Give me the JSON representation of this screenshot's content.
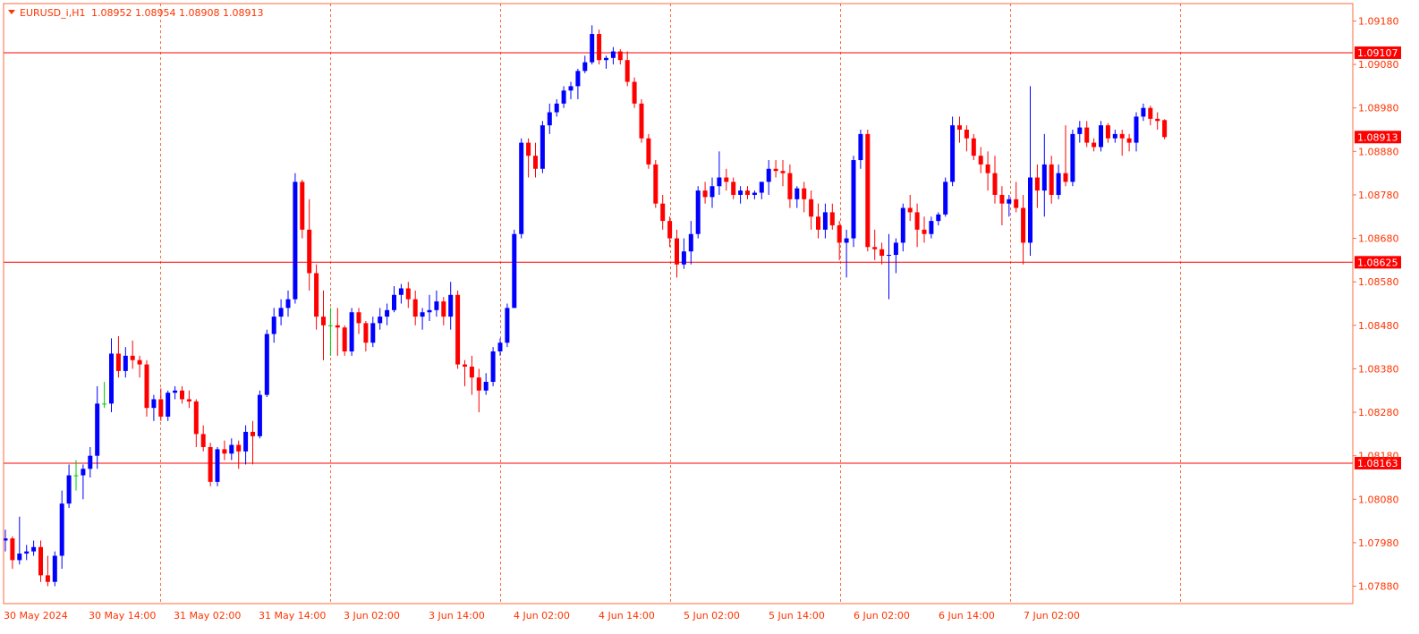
{
  "header": {
    "symbol": "EURUSD_i,H1",
    "ohlc": "1.08952 1.08954 1.08908 1.08913"
  },
  "colors": {
    "bull": "#0000ff",
    "bear": "#ff0000",
    "doji": "#00cc00",
    "grid": "#ff6a3d",
    "axis_text": "#ff3300",
    "border": "#ff6a3d",
    "level_line": "#ff0000",
    "tag_bg": "#ff0000",
    "tag_text": "#ffffff"
  },
  "chart_data": {
    "type": "candlestick",
    "symbol": "EURUSD_i",
    "timeframe": "H1",
    "ylim": [
      1.0784,
      1.0922
    ],
    "y_ticks": [
      "1.09180",
      "1.09080",
      "1.08980",
      "1.08880",
      "1.08780",
      "1.08680",
      "1.08580",
      "1.08480",
      "1.08380",
      "1.08280",
      "1.08180",
      "1.08080",
      "1.07980",
      "1.07880"
    ],
    "x_ticks": [
      "30 May 2024",
      "30 May 14:00",
      "31 May 02:00",
      "31 May 14:00",
      "3 Jun 02:00",
      "3 Jun 14:00",
      "4 Jun 02:00",
      "4 Jun 14:00",
      "5 Jun 02:00",
      "5 Jun 14:00",
      "6 Jun 02:00",
      "6 Jun 14:00",
      "7 Jun 02:00"
    ],
    "horizontal_levels": [
      "1.09107",
      "1.08625",
      "1.08163"
    ],
    "current_price": "1.08913",
    "grid": "vertical dashed",
    "candles": [
      {
        "o": 1.07985,
        "h": 1.0801,
        "l": 1.0796,
        "c": 1.0799
      },
      {
        "o": 1.0799,
        "h": 1.07995,
        "l": 1.0792,
        "c": 1.0794
      },
      {
        "o": 1.0794,
        "h": 1.0804,
        "l": 1.0793,
        "c": 1.07955
      },
      {
        "o": 1.07955,
        "h": 1.07975,
        "l": 1.0794,
        "c": 1.0796
      },
      {
        "o": 1.0796,
        "h": 1.07985,
        "l": 1.0795,
        "c": 1.0797
      },
      {
        "o": 1.0797,
        "h": 1.07985,
        "l": 1.0789,
        "c": 1.07905
      },
      {
        "o": 1.07905,
        "h": 1.0795,
        "l": 1.0788,
        "c": 1.0789
      },
      {
        "o": 1.0789,
        "h": 1.0796,
        "l": 1.0788,
        "c": 1.0795
      },
      {
        "o": 1.0795,
        "h": 1.081,
        "l": 1.0792,
        "c": 1.0807
      },
      {
        "o": 1.0807,
        "h": 1.0816,
        "l": 1.0806,
        "c": 1.08135
      },
      {
        "o": 1.08135,
        "h": 1.0817,
        "l": 1.081,
        "c": 1.08135
      },
      {
        "o": 1.08135,
        "h": 1.0816,
        "l": 1.0808,
        "c": 1.0815
      },
      {
        "o": 1.0815,
        "h": 1.082,
        "l": 1.0813,
        "c": 1.0818
      },
      {
        "o": 1.0818,
        "h": 1.0834,
        "l": 1.0815,
        "c": 1.083
      },
      {
        "o": 1.083,
        "h": 1.0835,
        "l": 1.0829,
        "c": 1.083
      },
      {
        "o": 1.083,
        "h": 1.0845,
        "l": 1.0828,
        "c": 1.08415
      },
      {
        "o": 1.08415,
        "h": 1.08455,
        "l": 1.0836,
        "c": 1.08375
      },
      {
        "o": 1.08375,
        "h": 1.0843,
        "l": 1.0836,
        "c": 1.0841
      },
      {
        "o": 1.0841,
        "h": 1.08445,
        "l": 1.0838,
        "c": 1.084
      },
      {
        "o": 1.084,
        "h": 1.0841,
        "l": 1.0836,
        "c": 1.0839
      },
      {
        "o": 1.0839,
        "h": 1.084,
        "l": 1.0827,
        "c": 1.0829
      },
      {
        "o": 1.0829,
        "h": 1.0832,
        "l": 1.0826,
        "c": 1.0831
      },
      {
        "o": 1.0831,
        "h": 1.08335,
        "l": 1.0826,
        "c": 1.0827
      },
      {
        "o": 1.0827,
        "h": 1.0833,
        "l": 1.0826,
        "c": 1.08325
      },
      {
        "o": 1.08325,
        "h": 1.0834,
        "l": 1.0831,
        "c": 1.0833
      },
      {
        "o": 1.0833,
        "h": 1.0834,
        "l": 1.083,
        "c": 1.0831
      },
      {
        "o": 1.0831,
        "h": 1.0833,
        "l": 1.0829,
        "c": 1.08305
      },
      {
        "o": 1.08305,
        "h": 1.0831,
        "l": 1.082,
        "c": 1.0823
      },
      {
        "o": 1.0823,
        "h": 1.0825,
        "l": 1.0819,
        "c": 1.082
      },
      {
        "o": 1.082,
        "h": 1.0821,
        "l": 1.0811,
        "c": 1.0812
      },
      {
        "o": 1.0812,
        "h": 1.082,
        "l": 1.0811,
        "c": 1.08195
      },
      {
        "o": 1.08195,
        "h": 1.08215,
        "l": 1.0817,
        "c": 1.08185
      },
      {
        "o": 1.08185,
        "h": 1.0822,
        "l": 1.0817,
        "c": 1.08205
      },
      {
        "o": 1.08205,
        "h": 1.08215,
        "l": 1.0815,
        "c": 1.0819
      },
      {
        "o": 1.0819,
        "h": 1.0825,
        "l": 1.0816,
        "c": 1.08235
      },
      {
        "o": 1.08235,
        "h": 1.0826,
        "l": 1.0816,
        "c": 1.08225
      },
      {
        "o": 1.08225,
        "h": 1.0833,
        "l": 1.0822,
        "c": 1.0832
      },
      {
        "o": 1.0832,
        "h": 1.0847,
        "l": 1.08315,
        "c": 1.0846
      },
      {
        "o": 1.0846,
        "h": 1.0852,
        "l": 1.0844,
        "c": 1.085
      },
      {
        "o": 1.085,
        "h": 1.0854,
        "l": 1.0848,
        "c": 1.0852
      },
      {
        "o": 1.0852,
        "h": 1.0856,
        "l": 1.085,
        "c": 1.0854
      },
      {
        "o": 1.0854,
        "h": 1.0883,
        "l": 1.0853,
        "c": 1.0881
      },
      {
        "o": 1.0881,
        "h": 1.08815,
        "l": 1.0868,
        "c": 1.087
      },
      {
        "o": 1.087,
        "h": 1.0877,
        "l": 1.0856,
        "c": 1.086
      },
      {
        "o": 1.086,
        "h": 1.0862,
        "l": 1.0847,
        "c": 1.085
      },
      {
        "o": 1.085,
        "h": 1.0856,
        "l": 1.084,
        "c": 1.0848
      },
      {
        "o": 1.0848,
        "h": 1.0852,
        "l": 1.0841,
        "c": 1.0848
      },
      {
        "o": 1.0848,
        "h": 1.0852,
        "l": 1.0841,
        "c": 1.08475
      },
      {
        "o": 1.08475,
        "h": 1.0848,
        "l": 1.0841,
        "c": 1.0842
      },
      {
        "o": 1.0842,
        "h": 1.0852,
        "l": 1.0841,
        "c": 1.0851
      },
      {
        "o": 1.0851,
        "h": 1.0852,
        "l": 1.0846,
        "c": 1.08485
      },
      {
        "o": 1.08485,
        "h": 1.0849,
        "l": 1.0842,
        "c": 1.0844
      },
      {
        "o": 1.0844,
        "h": 1.085,
        "l": 1.0843,
        "c": 1.08485
      },
      {
        "o": 1.08485,
        "h": 1.0852,
        "l": 1.0847,
        "c": 1.085
      },
      {
        "o": 1.085,
        "h": 1.0853,
        "l": 1.0848,
        "c": 1.08515
      },
      {
        "o": 1.08515,
        "h": 1.0857,
        "l": 1.0851,
        "c": 1.0855
      },
      {
        "o": 1.0855,
        "h": 1.08575,
        "l": 1.0853,
        "c": 1.08565
      },
      {
        "o": 1.08565,
        "h": 1.0858,
        "l": 1.0852,
        "c": 1.0854
      },
      {
        "o": 1.0854,
        "h": 1.0856,
        "l": 1.0848,
        "c": 1.085
      },
      {
        "o": 1.085,
        "h": 1.0852,
        "l": 1.0847,
        "c": 1.0851
      },
      {
        "o": 1.0851,
        "h": 1.0855,
        "l": 1.0849,
        "c": 1.08515
      },
      {
        "o": 1.08515,
        "h": 1.0856,
        "l": 1.085,
        "c": 1.08535
      },
      {
        "o": 1.08535,
        "h": 1.08545,
        "l": 1.0848,
        "c": 1.085
      },
      {
        "o": 1.085,
        "h": 1.0858,
        "l": 1.0847,
        "c": 1.0855
      },
      {
        "o": 1.0855,
        "h": 1.0856,
        "l": 1.0838,
        "c": 1.0839
      },
      {
        "o": 1.0839,
        "h": 1.084,
        "l": 1.0834,
        "c": 1.08385
      },
      {
        "o": 1.08385,
        "h": 1.0841,
        "l": 1.0832,
        "c": 1.0836
      },
      {
        "o": 1.0836,
        "h": 1.0838,
        "l": 1.0828,
        "c": 1.0833
      },
      {
        "o": 1.0833,
        "h": 1.0837,
        "l": 1.0832,
        "c": 1.0835
      },
      {
        "o": 1.0835,
        "h": 1.0843,
        "l": 1.0834,
        "c": 1.0842
      },
      {
        "o": 1.0842,
        "h": 1.0845,
        "l": 1.0841,
        "c": 1.0844
      },
      {
        "o": 1.0844,
        "h": 1.0853,
        "l": 1.0843,
        "c": 1.0852
      },
      {
        "o": 1.0852,
        "h": 1.087,
        "l": 1.0852,
        "c": 1.0869
      },
      {
        "o": 1.0869,
        "h": 1.0891,
        "l": 1.0868,
        "c": 1.089
      },
      {
        "o": 1.089,
        "h": 1.0891,
        "l": 1.0882,
        "c": 1.0887
      },
      {
        "o": 1.0887,
        "h": 1.089,
        "l": 1.0882,
        "c": 1.0884
      },
      {
        "o": 1.0884,
        "h": 1.0895,
        "l": 1.0883,
        "c": 1.0894
      },
      {
        "o": 1.0894,
        "h": 1.0899,
        "l": 1.0892,
        "c": 1.0897
      },
      {
        "o": 1.0897,
        "h": 1.09,
        "l": 1.0896,
        "c": 1.0899
      },
      {
        "o": 1.0899,
        "h": 1.0903,
        "l": 1.0898,
        "c": 1.0902
      },
      {
        "o": 1.0902,
        "h": 1.0904,
        "l": 1.09,
        "c": 1.0903
      },
      {
        "o": 1.0903,
        "h": 1.0907,
        "l": 1.09,
        "c": 1.09065
      },
      {
        "o": 1.09065,
        "h": 1.091,
        "l": 1.0906,
        "c": 1.09085
      },
      {
        "o": 1.09085,
        "h": 1.0917,
        "l": 1.0908,
        "c": 1.0915
      },
      {
        "o": 1.0915,
        "h": 1.0916,
        "l": 1.0908,
        "c": 1.0909
      },
      {
        "o": 1.0909,
        "h": 1.091,
        "l": 1.0907,
        "c": 1.09095
      },
      {
        "o": 1.09095,
        "h": 1.0912,
        "l": 1.0908,
        "c": 1.0911
      },
      {
        "o": 1.0911,
        "h": 1.09115,
        "l": 1.0908,
        "c": 1.0909
      },
      {
        "o": 1.0909,
        "h": 1.0911,
        "l": 1.0903,
        "c": 1.0904
      },
      {
        "o": 1.0904,
        "h": 1.0905,
        "l": 1.0898,
        "c": 1.0899
      },
      {
        "o": 1.0899,
        "h": 1.09,
        "l": 1.089,
        "c": 1.0891
      },
      {
        "o": 1.0891,
        "h": 1.0892,
        "l": 1.0884,
        "c": 1.0885
      },
      {
        "o": 1.0885,
        "h": 1.0886,
        "l": 1.0875,
        "c": 1.0876
      },
      {
        "o": 1.0876,
        "h": 1.0878,
        "l": 1.087,
        "c": 1.0872
      },
      {
        "o": 1.0872,
        "h": 1.0873,
        "l": 1.0866,
        "c": 1.0868
      },
      {
        "o": 1.0868,
        "h": 1.087,
        "l": 1.0859,
        "c": 1.0862
      },
      {
        "o": 1.0862,
        "h": 1.0868,
        "l": 1.0861,
        "c": 1.0865
      },
      {
        "o": 1.0865,
        "h": 1.0872,
        "l": 1.0862,
        "c": 1.0869
      },
      {
        "o": 1.0869,
        "h": 1.088,
        "l": 1.0868,
        "c": 1.0879
      },
      {
        "o": 1.0879,
        "h": 1.0881,
        "l": 1.0876,
        "c": 1.08775
      },
      {
        "o": 1.08775,
        "h": 1.0882,
        "l": 1.0875,
        "c": 1.088
      },
      {
        "o": 1.088,
        "h": 1.0888,
        "l": 1.0878,
        "c": 1.0882
      },
      {
        "o": 1.0882,
        "h": 1.0884,
        "l": 1.0879,
        "c": 1.0881
      },
      {
        "o": 1.0881,
        "h": 1.0882,
        "l": 1.0877,
        "c": 1.0878
      },
      {
        "o": 1.0878,
        "h": 1.088,
        "l": 1.0876,
        "c": 1.0879
      },
      {
        "o": 1.0879,
        "h": 1.088,
        "l": 1.0877,
        "c": 1.0878
      },
      {
        "o": 1.0878,
        "h": 1.0879,
        "l": 1.0877,
        "c": 1.08785
      },
      {
        "o": 1.08785,
        "h": 1.0881,
        "l": 1.0877,
        "c": 1.0881
      },
      {
        "o": 1.0881,
        "h": 1.0886,
        "l": 1.0878,
        "c": 1.0884
      },
      {
        "o": 1.0884,
        "h": 1.0886,
        "l": 1.0882,
        "c": 1.08835
      },
      {
        "o": 1.08835,
        "h": 1.0886,
        "l": 1.088,
        "c": 1.0883
      },
      {
        "o": 1.0883,
        "h": 1.0885,
        "l": 1.0875,
        "c": 1.0877
      },
      {
        "o": 1.0877,
        "h": 1.088,
        "l": 1.0875,
        "c": 1.08795
      },
      {
        "o": 1.08795,
        "h": 1.0881,
        "l": 1.0874,
        "c": 1.0877
      },
      {
        "o": 1.0877,
        "h": 1.0879,
        "l": 1.087,
        "c": 1.0873
      },
      {
        "o": 1.0873,
        "h": 1.0876,
        "l": 1.0868,
        "c": 1.087
      },
      {
        "o": 1.087,
        "h": 1.0876,
        "l": 1.0868,
        "c": 1.0874
      },
      {
        "o": 1.0874,
        "h": 1.0876,
        "l": 1.087,
        "c": 1.0871
      },
      {
        "o": 1.0871,
        "h": 1.0872,
        "l": 1.0863,
        "c": 1.0867
      },
      {
        "o": 1.0867,
        "h": 1.087,
        "l": 1.0859,
        "c": 1.0868
      },
      {
        "o": 1.0868,
        "h": 1.0887,
        "l": 1.0866,
        "c": 1.0886
      },
      {
        "o": 1.0886,
        "h": 1.0893,
        "l": 1.0884,
        "c": 1.0892
      },
      {
        "o": 1.0892,
        "h": 1.0893,
        "l": 1.0865,
        "c": 1.0866
      },
      {
        "o": 1.0866,
        "h": 1.087,
        "l": 1.0863,
        "c": 1.08655
      },
      {
        "o": 1.08655,
        "h": 1.0867,
        "l": 1.0862,
        "c": 1.0864
      },
      {
        "o": 1.0864,
        "h": 1.0869,
        "l": 1.0854,
        "c": 1.08642
      },
      {
        "o": 1.08642,
        "h": 1.0868,
        "l": 1.086,
        "c": 1.0867
      },
      {
        "o": 1.0867,
        "h": 1.0876,
        "l": 1.0865,
        "c": 1.0875
      },
      {
        "o": 1.0875,
        "h": 1.0878,
        "l": 1.0872,
        "c": 1.0874
      },
      {
        "o": 1.0874,
        "h": 1.0876,
        "l": 1.0866,
        "c": 1.087
      },
      {
        "o": 1.087,
        "h": 1.0873,
        "l": 1.0867,
        "c": 1.0869
      },
      {
        "o": 1.0869,
        "h": 1.0873,
        "l": 1.0868,
        "c": 1.0872
      },
      {
        "o": 1.0872,
        "h": 1.0874,
        "l": 1.0871,
        "c": 1.08735
      },
      {
        "o": 1.08735,
        "h": 1.0882,
        "l": 1.0873,
        "c": 1.0881
      },
      {
        "o": 1.0881,
        "h": 1.0896,
        "l": 1.088,
        "c": 1.0894
      },
      {
        "o": 1.0894,
        "h": 1.0896,
        "l": 1.089,
        "c": 1.0893
      },
      {
        "o": 1.0893,
        "h": 1.0894,
        "l": 1.0888,
        "c": 1.0891
      },
      {
        "o": 1.0891,
        "h": 1.0892,
        "l": 1.0886,
        "c": 1.0887
      },
      {
        "o": 1.0887,
        "h": 1.0889,
        "l": 1.0883,
        "c": 1.0885
      },
      {
        "o": 1.0885,
        "h": 1.0888,
        "l": 1.0879,
        "c": 1.0883
      },
      {
        "o": 1.0883,
        "h": 1.0887,
        "l": 1.0876,
        "c": 1.0878
      },
      {
        "o": 1.0878,
        "h": 1.088,
        "l": 1.0871,
        "c": 1.0876
      },
      {
        "o": 1.0876,
        "h": 1.0878,
        "l": 1.0873,
        "c": 1.0877
      },
      {
        "o": 1.0877,
        "h": 1.0881,
        "l": 1.0874,
        "c": 1.0875
      },
      {
        "o": 1.0875,
        "h": 1.0878,
        "l": 1.0862,
        "c": 1.0867
      },
      {
        "o": 1.0867,
        "h": 1.0903,
        "l": 1.0864,
        "c": 1.0882
      },
      {
        "o": 1.0882,
        "h": 1.0885,
        "l": 1.0875,
        "c": 1.0879
      },
      {
        "o": 1.0879,
        "h": 1.0892,
        "l": 1.0873,
        "c": 1.0885
      },
      {
        "o": 1.0885,
        "h": 1.0887,
        "l": 1.0876,
        "c": 1.0878
      },
      {
        "o": 1.0878,
        "h": 1.0885,
        "l": 1.0877,
        "c": 1.0883
      },
      {
        "o": 1.0883,
        "h": 1.0894,
        "l": 1.088,
        "c": 1.0881
      },
      {
        "o": 1.0881,
        "h": 1.0893,
        "l": 1.088,
        "c": 1.0892
      },
      {
        "o": 1.0892,
        "h": 1.0895,
        "l": 1.089,
        "c": 1.08935
      },
      {
        "o": 1.08935,
        "h": 1.0895,
        "l": 1.0889,
        "c": 1.089
      },
      {
        "o": 1.089,
        "h": 1.0891,
        "l": 1.0888,
        "c": 1.0889
      },
      {
        "o": 1.0889,
        "h": 1.0895,
        "l": 1.0888,
        "c": 1.0894
      },
      {
        "o": 1.0894,
        "h": 1.08945,
        "l": 1.089,
        "c": 1.0891
      },
      {
        "o": 1.0891,
        "h": 1.0893,
        "l": 1.089,
        "c": 1.0892
      },
      {
        "o": 1.0892,
        "h": 1.0893,
        "l": 1.0887,
        "c": 1.0891
      },
      {
        "o": 1.0891,
        "h": 1.0892,
        "l": 1.0888,
        "c": 1.089
      },
      {
        "o": 1.089,
        "h": 1.0897,
        "l": 1.0888,
        "c": 1.0896
      },
      {
        "o": 1.0896,
        "h": 1.0899,
        "l": 1.0895,
        "c": 1.0898
      },
      {
        "o": 1.0898,
        "h": 1.08985,
        "l": 1.0894,
        "c": 1.08955
      },
      {
        "o": 1.08955,
        "h": 1.0897,
        "l": 1.0893,
        "c": 1.0895
      },
      {
        "o": 1.08952,
        "h": 1.08954,
        "l": 1.08908,
        "c": 1.08913
      }
    ]
  }
}
